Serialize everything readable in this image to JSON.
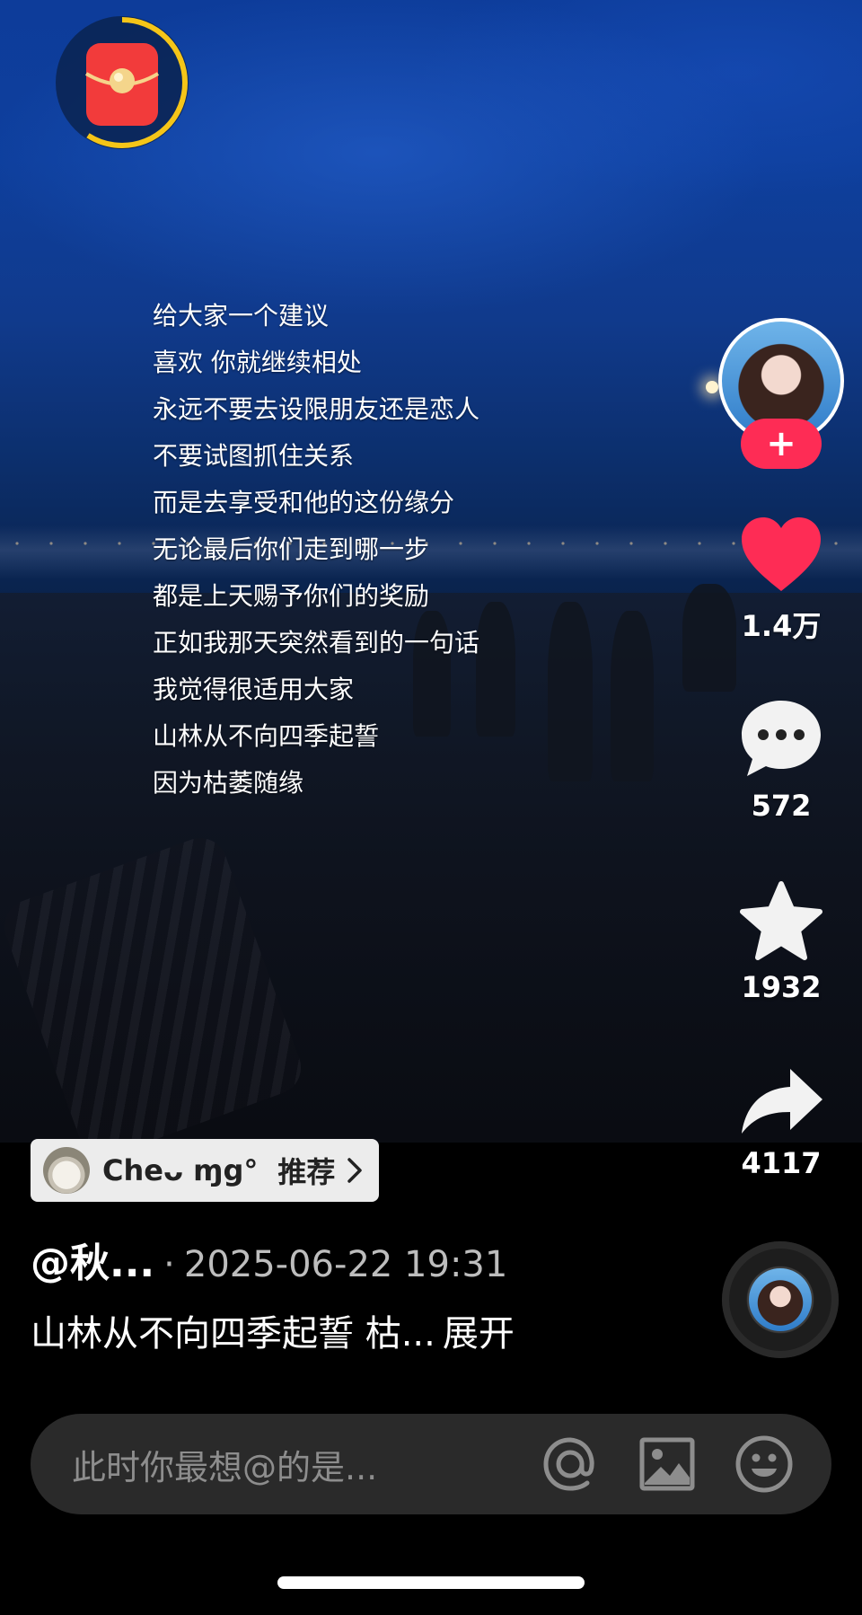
{
  "lyrics": [
    "给大家一个建议",
    "喜欢 你就继续相处",
    "永远不要去设限朋友还是恋人",
    "不要试图抓住关系",
    "而是去享受和他的这份缘分",
    "无论最后你们走到哪一步",
    "都是上天赐予你们的奖励",
    "正如我那天突然看到的一句话",
    "我觉得很适用大家",
    "山林从不向四季起誓",
    "因为枯萎随缘"
  ],
  "rail": {
    "follow_label": "+",
    "likes": "1.4万",
    "comments": "572",
    "favorites": "1932",
    "shares": "4117"
  },
  "recommend": {
    "name": "Cheᴗ ɱg°",
    "tag": "推荐"
  },
  "post": {
    "author": "@秋...",
    "separator": "·",
    "time": "2025-06-22 19:31",
    "caption": "山林从不向四季起誓 枯...",
    "expand": "展开"
  },
  "comment_bar": {
    "placeholder": "此时你最想@的是..."
  },
  "colors": {
    "like_red": "#fe2c55",
    "envelope_ring": "#f5c518"
  }
}
